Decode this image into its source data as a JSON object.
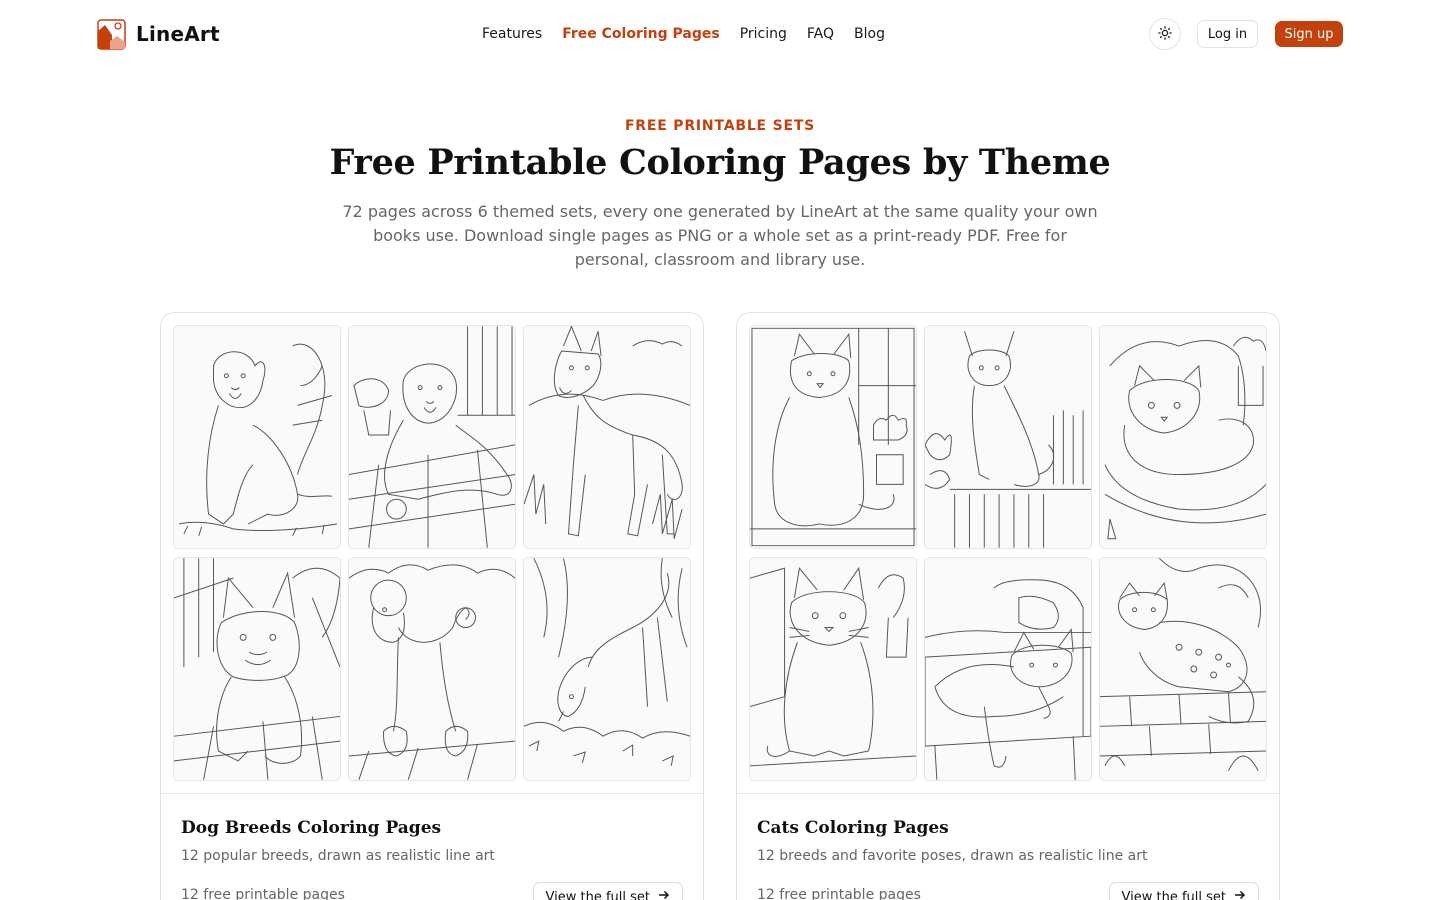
{
  "brand": {
    "name": "LineArt",
    "accent": "#c2410c"
  },
  "nav": {
    "items": [
      {
        "label": "Features",
        "active": false
      },
      {
        "label": "Free Coloring Pages",
        "active": true
      },
      {
        "label": "Pricing",
        "active": false
      },
      {
        "label": "FAQ",
        "active": false
      },
      {
        "label": "Blog",
        "active": false
      }
    ],
    "theme_icon": "sun-icon",
    "login_label": "Log in",
    "signup_label": "Sign up"
  },
  "hero": {
    "eyebrow": "FREE PRINTABLE SETS",
    "title": "Free Printable Coloring Pages by Theme",
    "subtitle": "72 pages across 6 themed sets, every one generated by LineArt at the same quality your own books use. Download single pages as PNG or a whole set as a print-ready PDF. Free for personal, classroom and library use."
  },
  "sets": [
    {
      "title": "Dog Breeds Coloring Pages",
      "description": "12 popular breeds, drawn as realistic line art",
      "count": "12 free printable pages",
      "button": "View the full set",
      "thumbs": [
        "labrador-sitting",
        "golden-retriever-porch",
        "german-shepherd-standing",
        "french-bulldog-sitting",
        "poodle-standing",
        "beagle-sniffing"
      ]
    },
    {
      "title": "Cats Coloring Pages",
      "description": "12 breeds and favorite poses, drawn as realistic line art",
      "count": "12 free printable pages",
      "button": "View the full set",
      "thumbs": [
        "maine-coon-window",
        "siamese-on-books",
        "persian-on-cushion",
        "british-shorthair-sitting",
        "ragdoll-on-sofa",
        "bengal-on-wall"
      ]
    }
  ]
}
